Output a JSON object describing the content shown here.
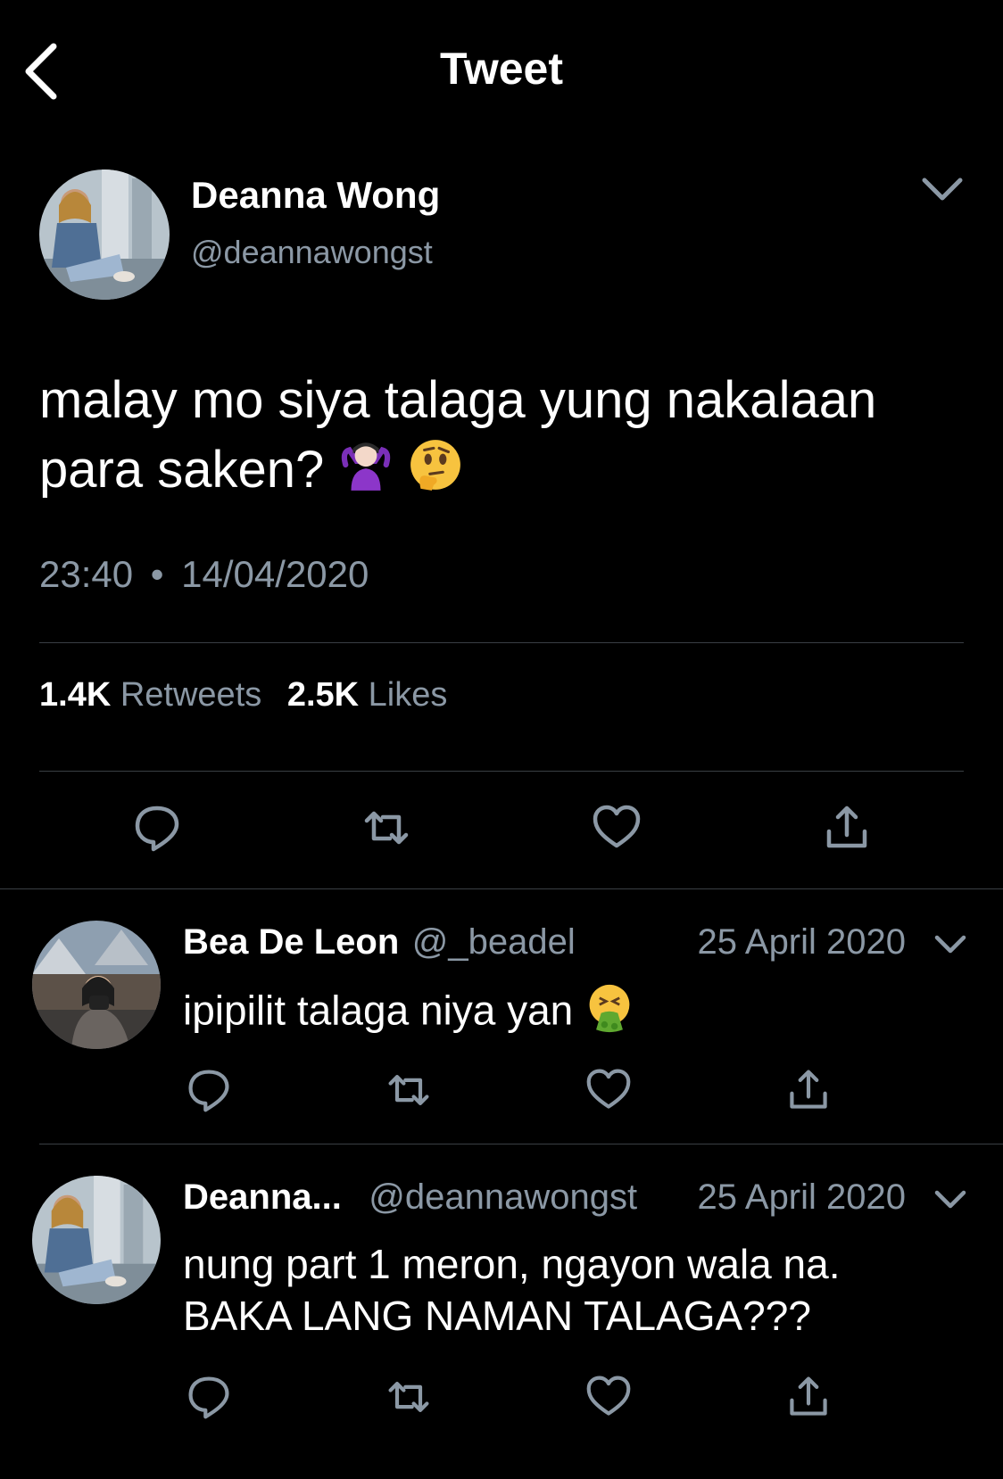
{
  "header": {
    "title": "Tweet"
  },
  "tweet": {
    "author_name": "Deanna Wong",
    "author_handle": "@deannawongst",
    "text_line1": "malay mo siya talaga yung nakalaan",
    "text_line2": "para saken?",
    "emojis": [
      "person-shrugging",
      "thinking-face"
    ],
    "time": "23:40",
    "separator": "•",
    "date": "14/04/2020",
    "retweets_count": "1.4K",
    "retweets_label": "Retweets",
    "likes_count": "2.5K",
    "likes_label": "Likes"
  },
  "replies": [
    {
      "author_name": "Bea De Leon",
      "author_handle": "@_beadel",
      "date": "25 April 2020",
      "text_line1": "ipipilit talaga niya yan",
      "emoji": "face-vomiting"
    },
    {
      "author_name": "Deanna...",
      "author_handle": "@deannawongst",
      "date": "25 April 2020",
      "text_line1": "nung part 1 meron, ngayon wala na.",
      "text_line2": "BAKA LANG NAMAN TALAGA???"
    }
  ],
  "colors": {
    "background": "#000000",
    "text": "#ffffff",
    "secondary": "#8b98a5",
    "divider": "#3a3f44"
  },
  "icons": [
    "back-icon",
    "chevron-down-icon",
    "reply-icon",
    "retweet-icon",
    "like-icon",
    "share-icon"
  ]
}
